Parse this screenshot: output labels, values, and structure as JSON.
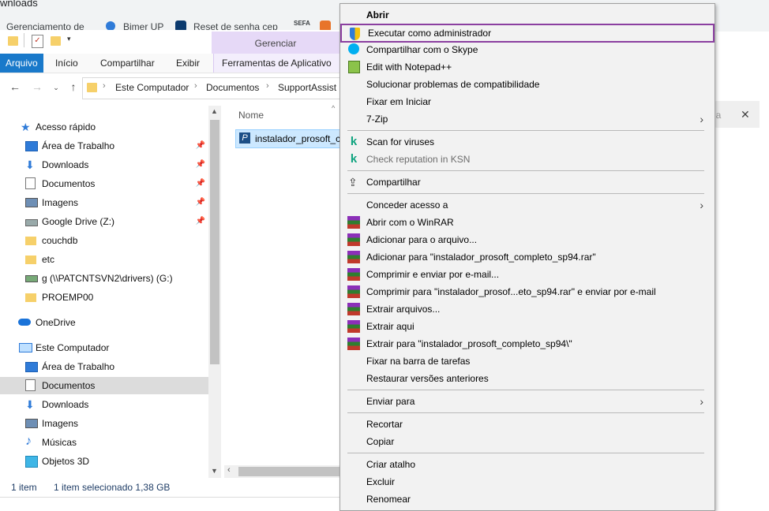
{
  "browser": {
    "page_fragment": "wnloads",
    "bookmarks": [
      "Gerenciamento de",
      "Bimer UP",
      "Reset de senha cep",
      "SEFA"
    ]
  },
  "ribbon": {
    "context_group": "Gerenciar",
    "tabs": [
      "Arquivo",
      "Início",
      "Compartilhar",
      "Exibir",
      "Ferramentas de Aplicativo"
    ]
  },
  "breadcrumb": [
    "Este Computador",
    "Documentos",
    "SupportAssist"
  ],
  "nav_pane": {
    "quick_access": "Acesso rápido",
    "quick_items": [
      {
        "label": "Área de Trabalho",
        "icon": "desktop-icon",
        "pinned": true
      },
      {
        "label": "Downloads",
        "icon": "download-arrow-icon",
        "pinned": true
      },
      {
        "label": "Documentos",
        "icon": "document-icon",
        "pinned": true
      },
      {
        "label": "Imagens",
        "icon": "pictures-icon",
        "pinned": true
      },
      {
        "label": "Google Drive (Z:)",
        "icon": "drive-icon",
        "pinned": true
      },
      {
        "label": "couchdb",
        "icon": "folder-icon",
        "pinned": false
      },
      {
        "label": "etc",
        "icon": "folder-icon",
        "pinned": false
      },
      {
        "label": "g (\\\\PATCNTSVN2\\drivers) (G:)",
        "icon": "network-drive-icon",
        "pinned": false
      },
      {
        "label": "PROEMP00",
        "icon": "folder-icon",
        "pinned": false
      }
    ],
    "onedrive": "OneDrive",
    "this_pc": "Este Computador",
    "pc_items": [
      {
        "label": "Área de Trabalho",
        "icon": "desktop-icon"
      },
      {
        "label": "Documentos",
        "icon": "document-icon",
        "selected": true
      },
      {
        "label": "Downloads",
        "icon": "download-arrow-icon"
      },
      {
        "label": "Imagens",
        "icon": "pictures-icon"
      },
      {
        "label": "Músicas",
        "icon": "music-icon"
      },
      {
        "label": "Objetos 3D",
        "icon": "cube-icon"
      }
    ]
  },
  "file_list": {
    "column_name": "Nome",
    "files": [
      "instalador_prosoft_c"
    ]
  },
  "status_bar": {
    "count": "1 item",
    "selection": "1 item selecionado  1,38 GB"
  },
  "right_remnant": {
    "text": "ia",
    "close": "✕"
  },
  "context_menu": {
    "items": [
      {
        "label": "Abrir",
        "bold": true
      },
      {
        "label": "Executar como administrador",
        "icon": "shield-icon",
        "highlight": true
      },
      {
        "label": "Compartilhar com o Skype",
        "icon": "skype-icon"
      },
      {
        "label": "Edit with Notepad++",
        "icon": "notepadpp-icon"
      },
      {
        "label": "Solucionar problemas de compatibilidade"
      },
      {
        "label": "Fixar em Iniciar"
      },
      {
        "label": "7-Zip",
        "submenu": true
      },
      {
        "sep": true
      },
      {
        "label": "Scan for viruses",
        "icon": "kaspersky-icon"
      },
      {
        "label": "Check reputation in KSN",
        "icon": "kaspersky-icon",
        "dim": true
      },
      {
        "sep": true
      },
      {
        "label": "Compartilhar",
        "icon": "share-icon"
      },
      {
        "sep": true
      },
      {
        "label": "Conceder acesso a",
        "submenu": true
      },
      {
        "label": "Abrir com o WinRAR",
        "icon": "winrar-icon"
      },
      {
        "label": "Adicionar para o arquivo...",
        "icon": "winrar-icon"
      },
      {
        "label": "Adicionar para \"instalador_prosoft_completo_sp94.rar\"",
        "icon": "winrar-icon"
      },
      {
        "label": "Comprimir e enviar por e-mail...",
        "icon": "winrar-icon"
      },
      {
        "label": "Comprimir para \"instalador_prosof...eto_sp94.rar\" e enviar por e-mail",
        "icon": "winrar-icon"
      },
      {
        "label": "Extrair arquivos...",
        "icon": "winrar-icon"
      },
      {
        "label": "Extrair aqui",
        "icon": "winrar-icon"
      },
      {
        "label": "Extrair para \"instalador_prosoft_completo_sp94\\\"",
        "icon": "winrar-icon"
      },
      {
        "label": "Fixar na barra de tarefas"
      },
      {
        "label": "Restaurar versões anteriores"
      },
      {
        "sep": true
      },
      {
        "label": "Enviar para",
        "submenu": true
      },
      {
        "sep": true
      },
      {
        "label": "Recortar"
      },
      {
        "label": "Copiar"
      },
      {
        "sep": true
      },
      {
        "label": "Criar atalho"
      },
      {
        "label": "Excluir"
      },
      {
        "label": "Renomear"
      }
    ]
  }
}
